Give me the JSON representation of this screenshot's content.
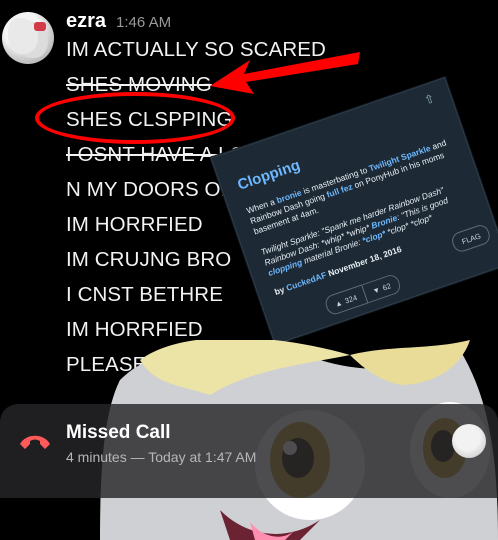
{
  "message": {
    "username": "ezra",
    "time": "1:46 AM",
    "lines": [
      "IM ACTUALLY SO SCARED",
      "SHES MOVING",
      "SHES CLSPPING",
      "I OSNT HAVE A LOCK",
      "N MY DOORS OPENS",
      "IM HORRFIED",
      "IM CRUJNG BRO",
      "I CNST BETHRE",
      "IM HORRFIED",
      "PLEASE"
    ]
  },
  "card": {
    "title": "Clopping",
    "body_line1_a": "When a ",
    "body_brony": "bronie",
    "body_line1_b": " is masterbating to ",
    "body_twilight": "Twilight Sparkle",
    "body_line1_c": " and Rainbow Dash going ",
    "body_fullfez": "full fez",
    "body_line1_d": " on PonyHub in his moms basement at 4am.",
    "body_quote_a": "Twilight Sparkle: \"Spank me harder Rainbow Dash\" Rainbow Dash: *whip* *whip* ",
    "body_bronie2": "Bronie",
    "body_quote_b": ": \"This is good ",
    "body_clopping": "clopping",
    "body_quote_c": " material Bronie: ",
    "body_clop": "*clop*",
    "body_quote_d": " *clop* *clop*",
    "byline_prefix": "by ",
    "author": "CuckedAF",
    "date": "November 18, 2016",
    "upvotes": "324",
    "downvotes": "62",
    "flag": "FLAG"
  },
  "call": {
    "title": "Missed Call",
    "subtitle": "4 minutes — Today at 1:47 AM"
  },
  "colors": {
    "annotation": "#ff0000",
    "link_blue": "#6db8ff",
    "missed_call_red": "#ff5a5a"
  }
}
